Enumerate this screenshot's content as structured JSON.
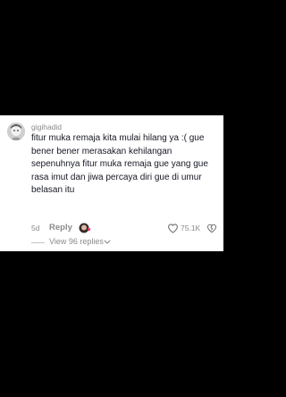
{
  "comment": {
    "username": "gigihadid",
    "text": "fitur muka remaja kita mulai hilang ya :( gue bener bener merasakan kehilangan sepenuhnya fitur muka remaja gue yang gue rasa imut dan jiwa percaya diri gue di umur belasan itu",
    "timestamp": "5d",
    "reply_label": "Reply",
    "like_count": "75.1K",
    "view_replies_label": "View 96 replies"
  },
  "icons": {
    "avatar": "user-avatar",
    "creator_liked": "creator-liked-avatar",
    "like": "heart-icon",
    "dislike": "dislike-icon",
    "expand": "chevron-down-icon"
  },
  "colors": {
    "background": "#000000",
    "card": "#ffffff",
    "text": "#161823",
    "muted": "#8a8a8a"
  }
}
